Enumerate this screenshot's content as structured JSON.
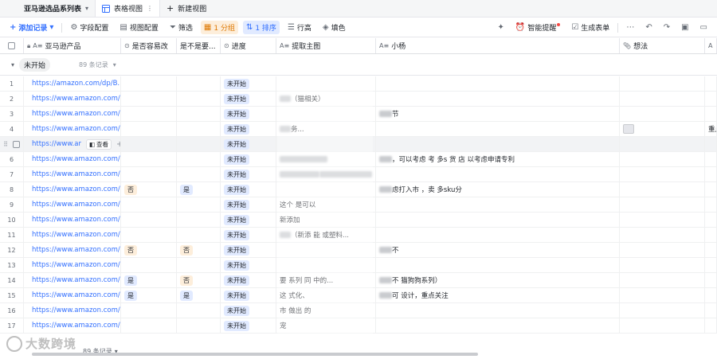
{
  "tabs": {
    "base_name": "亚马逊选品系列表",
    "table_view": "表格视图",
    "new_view": "新建视图"
  },
  "toolbar": {
    "add_record": "添加记录",
    "field_config": "字段配置",
    "view_config": "视图配置",
    "filter": "筛选",
    "group": "1 分组",
    "sort": "1 排序",
    "row_height": "行高",
    "fill_color": "填色",
    "smart_remind": "智能提醒",
    "generate_form": "生成表单"
  },
  "columns": [
    {
      "label": "亚马逊产品",
      "icon": "text-icon"
    },
    {
      "label": "是否容易改",
      "icon": "select-icon"
    },
    {
      "label": "是不是要...",
      "icon": ""
    },
    {
      "label": "进度",
      "icon": "select-icon"
    },
    {
      "label": "提取主图",
      "icon": "text-icon"
    },
    {
      "label": "小杨",
      "icon": "text-icon"
    },
    {
      "label": "想法",
      "icon": "attachment-icon"
    },
    {
      "label": "A",
      "icon": "text-icon"
    }
  ],
  "group": {
    "label": "未开始",
    "count": "89 条记录"
  },
  "view_chip": "查看",
  "rows": [
    {
      "n": "1",
      "url": "https://amazon.com/dp/B...",
      "easy": "",
      "need": "",
      "progress": "未开始",
      "pic": "",
      "yang": "",
      "idea": "",
      "extra": ""
    },
    {
      "n": "2",
      "url": "https://www.amazon.com/...",
      "easy": "",
      "need": "",
      "progress": "未开始",
      "pic": "（猫相关）",
      "yang": "",
      "idea": "",
      "extra": ""
    },
    {
      "n": "3",
      "url": "https://www.amazon.com/...",
      "easy": "",
      "need": "",
      "progress": "未开始",
      "pic": "",
      "yang": "节",
      "idea": "",
      "extra": ""
    },
    {
      "n": "4",
      "url": "https://www.amazon.com/...",
      "easy": "",
      "need": "",
      "progress": "未开始",
      "pic": "务...",
      "yang": "",
      "idea": "thumb",
      "extra": "重点"
    },
    {
      "n": "",
      "url": "https://www.ar",
      "easy": "",
      "need": "",
      "progress": "未开始",
      "pic": "",
      "yang": "",
      "idea": "",
      "extra": ""
    },
    {
      "n": "6",
      "url": "https://www.amazon.com/...",
      "easy": "",
      "need": "",
      "progress": "未开始",
      "pic": "",
      "yang": "，可以考虑 考 多s 货 店 以考虑申请专利",
      "idea": "",
      "extra": ""
    },
    {
      "n": "7",
      "url": "https://www.amazon.com/...",
      "easy": "",
      "need": "",
      "progress": "未开始",
      "pic": "",
      "yang": "",
      "idea": "",
      "extra": ""
    },
    {
      "n": "8",
      "url": "https://www.amazon.com/...",
      "easy": "否",
      "need": "是",
      "progress": "未开始",
      "pic": "",
      "yang": "虑打入市 ，卖 多sku分",
      "idea": "",
      "extra": ""
    },
    {
      "n": "9",
      "url": "https://www.amazon.com/...",
      "easy": "",
      "need": "",
      "progress": "未开始",
      "pic": "这个 是可以",
      "yang": "",
      "idea": "",
      "extra": ""
    },
    {
      "n": "10",
      "url": "https://www.amazon.com/...",
      "easy": "",
      "need": "",
      "progress": "未开始",
      "pic": "新添加",
      "yang": "",
      "idea": "",
      "extra": ""
    },
    {
      "n": "11",
      "url": "https://www.amazon.com/...",
      "easy": "",
      "need": "",
      "progress": "未开始",
      "pic": "（新添 能 或塑料...",
      "yang": "",
      "idea": "",
      "extra": ""
    },
    {
      "n": "12",
      "url": "https://www.amazon.com/...",
      "easy": "否",
      "need": "否",
      "progress": "未开始",
      "pic": "",
      "yang": "不",
      "idea": "",
      "extra": ""
    },
    {
      "n": "13",
      "url": "https://www.amazon.com/...",
      "easy": "",
      "need": "",
      "progress": "未开始",
      "pic": "",
      "yang": "",
      "idea": "",
      "extra": ""
    },
    {
      "n": "14",
      "url": "https://www.amazon.com/...",
      "easy": "是",
      "need": "否",
      "progress": "未开始",
      "pic": "要 系列 同 中的...",
      "yang": "不 猫狗狗系列）",
      "idea": "",
      "extra": ""
    },
    {
      "n": "15",
      "url": "https://www.amazon.com/...",
      "easy": "是",
      "need": "是",
      "progress": "未开始",
      "pic": "这 式化、",
      "yang": "可 设计，重点关注",
      "idea": "",
      "extra": ""
    },
    {
      "n": "16",
      "url": "https://www.amazon.com/...",
      "easy": "",
      "need": "",
      "progress": "未开始",
      "pic": "市 做出 的",
      "yang": "",
      "idea": "",
      "extra": ""
    },
    {
      "n": "17",
      "url": "https://www.amazon.com/...",
      "easy": "",
      "need": "",
      "progress": "未开始",
      "pic": "宠",
      "yang": "",
      "idea": "",
      "extra": ""
    }
  ],
  "footer": {
    "count": "89 条记录"
  },
  "watermark": "大数跨境"
}
